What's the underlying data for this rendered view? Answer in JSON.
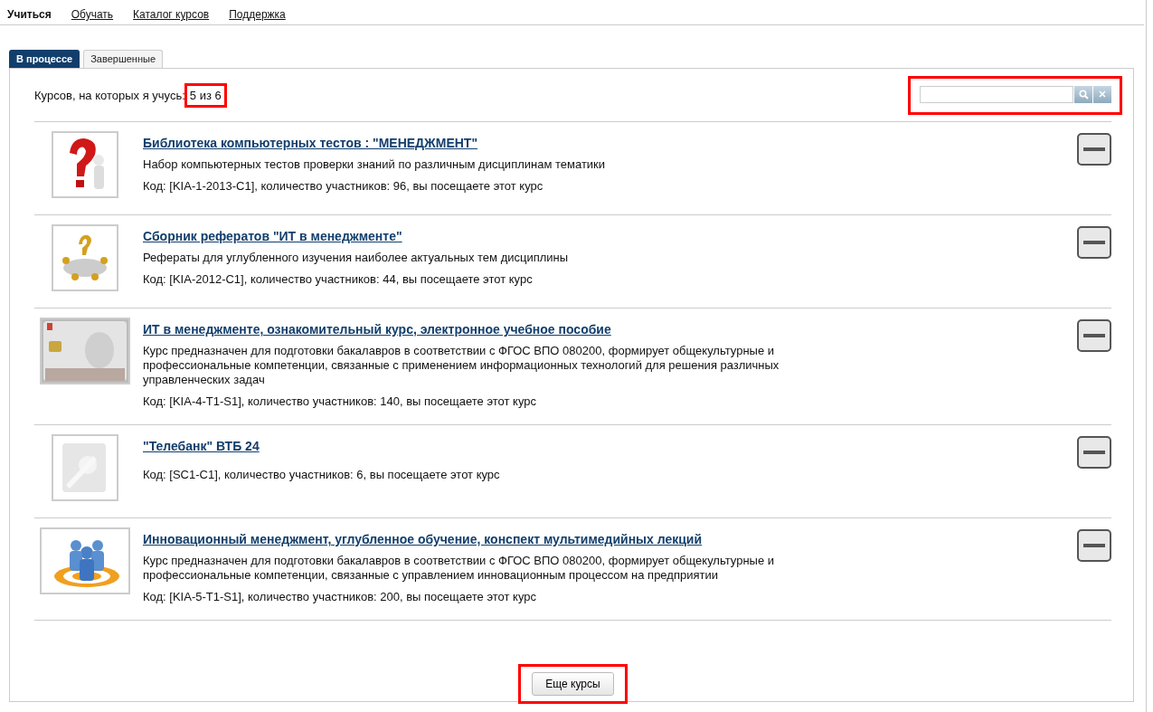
{
  "nav": [
    {
      "label": "Учиться",
      "selected": true
    },
    {
      "label": "Обучать",
      "selected": false
    },
    {
      "label": "Каталог курсов",
      "selected": false
    },
    {
      "label": "Поддержка",
      "selected": false
    }
  ],
  "tabs": [
    {
      "label": "В процессе",
      "selected": true
    },
    {
      "label": "Завершенные",
      "selected": false
    }
  ],
  "count": {
    "label": "Курсов, на которых я учусь:",
    "value": "5 из 6",
    "highlighted": true
  },
  "search": {
    "highlighted": true
  },
  "courses": [
    {
      "title": "Библиотека компьютерных тестов : \"МЕНЕДЖМЕНТ\"",
      "description": "Набор компьютерных тестов проверки знаний по различным дисциплинам тематики",
      "meta": "Код: [KIA-1-2013-C1], количество участников: 96, вы посещаете этот курс"
    },
    {
      "title": "Сборник рефератов \"ИТ в менеджменте\"",
      "description": "Рефераты для углубленного изучения наиболее актуальных тем дисциплины",
      "meta": "Код: [KIA-2012-C1], количество участников: 44, вы посещаете этот курс"
    },
    {
      "title": "ИТ в менеджменте, ознакомительный курс, электронное учебное пособие",
      "description": "Курс предназначен для подготовки бакалавров в соответствии с ФГОС ВПО 080200, формирует общекультурные и профессиональные компетенции, связанные с применением информационных технологий для решения различных управленческих задач",
      "meta": "Код: [KIA-4-T1-S1], количество участников: 140, вы посещаете этот курс"
    },
    {
      "title": "\"Телебанк\" ВТБ 24",
      "meta": "Код: [SC1-C1], количество участников: 6, вы посещаете этот курс"
    },
    {
      "title": "Инновационный менеджмент, углубленное обучение, конспект мультимедийных лекций",
      "description": "Курс предназначен для подготовки бакалавров в соответствии с ФГОС ВПО 080200, формирует общекультурные и профессиональные компетенции, связанные с управлением инновационным процессом на предприятии",
      "meta": "Код: [KIA-5-T1-S1], количество участников: 200, вы посещаете этот курс"
    }
  ],
  "more_button": {
    "label": "Еще курсы",
    "highlighted": true
  }
}
